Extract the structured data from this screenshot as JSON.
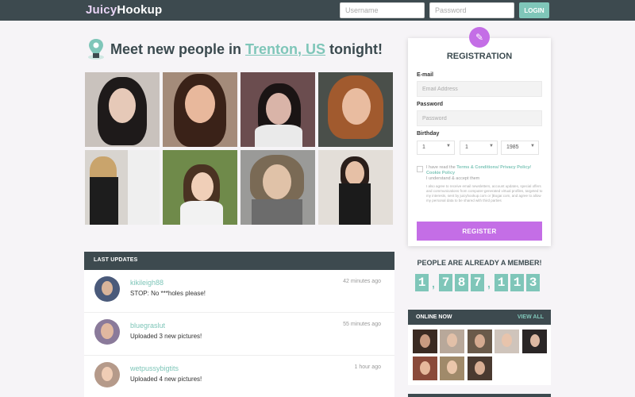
{
  "header": {
    "logo_main": "Juicy",
    "logo_accent": "Hookup",
    "username_placeholder": "Username",
    "password_placeholder": "Password",
    "login_label": "LOGIN"
  },
  "hero": {
    "prefix": "Meet new people in ",
    "city": "Trenton, US",
    "suffix": " tonight!"
  },
  "registration": {
    "title": "REGISTRATION",
    "email_label": "E-mail",
    "email_placeholder": "Email Address",
    "password_label": "Password",
    "password_placeholder": "Password",
    "birthday_label": "Birthday",
    "day": "1",
    "month": "1",
    "year": "1985",
    "terms_prefix": "I have read the ",
    "terms_link": "Terms & Conditions/ Privacy Policy/ Cookie Policy",
    "terms_suffix": "I understand & accept them",
    "terms_small": "I also agree to receive email newsletters, account updates, special offers and communications from computer-generated virtual profiles, targeted to my interests, sent by juicyhookup.com or ]Bogar.com, and agree to allow my personal data to be shared with third parties",
    "register_label": "REGISTER"
  },
  "members": {
    "title": "PEOPLE ARE ALREADY A MEMBER!",
    "digits": [
      "1",
      "7",
      "8",
      "7",
      "1",
      "1",
      "3"
    ]
  },
  "updates": {
    "title": "LAST UPDATES",
    "items": [
      {
        "name": "kikileigh88",
        "text": "STOP: No ***holes please!",
        "time": "42 minutes ago"
      },
      {
        "name": "bluegraslut",
        "text": "Uploaded 3 new pictures!",
        "time": "55 minutes ago"
      },
      {
        "name": "wetpussybigtits",
        "text": "Uploaded 4 new pictures!",
        "time": "1 hour ago"
      }
    ]
  },
  "online": {
    "title": "ONLINE NOW",
    "view_all": "VIEW ALL"
  },
  "colors": {
    "header_bg": "#3d4a4f",
    "accent_teal": "#7fc6b9",
    "accent_purple": "#c46ee6"
  }
}
